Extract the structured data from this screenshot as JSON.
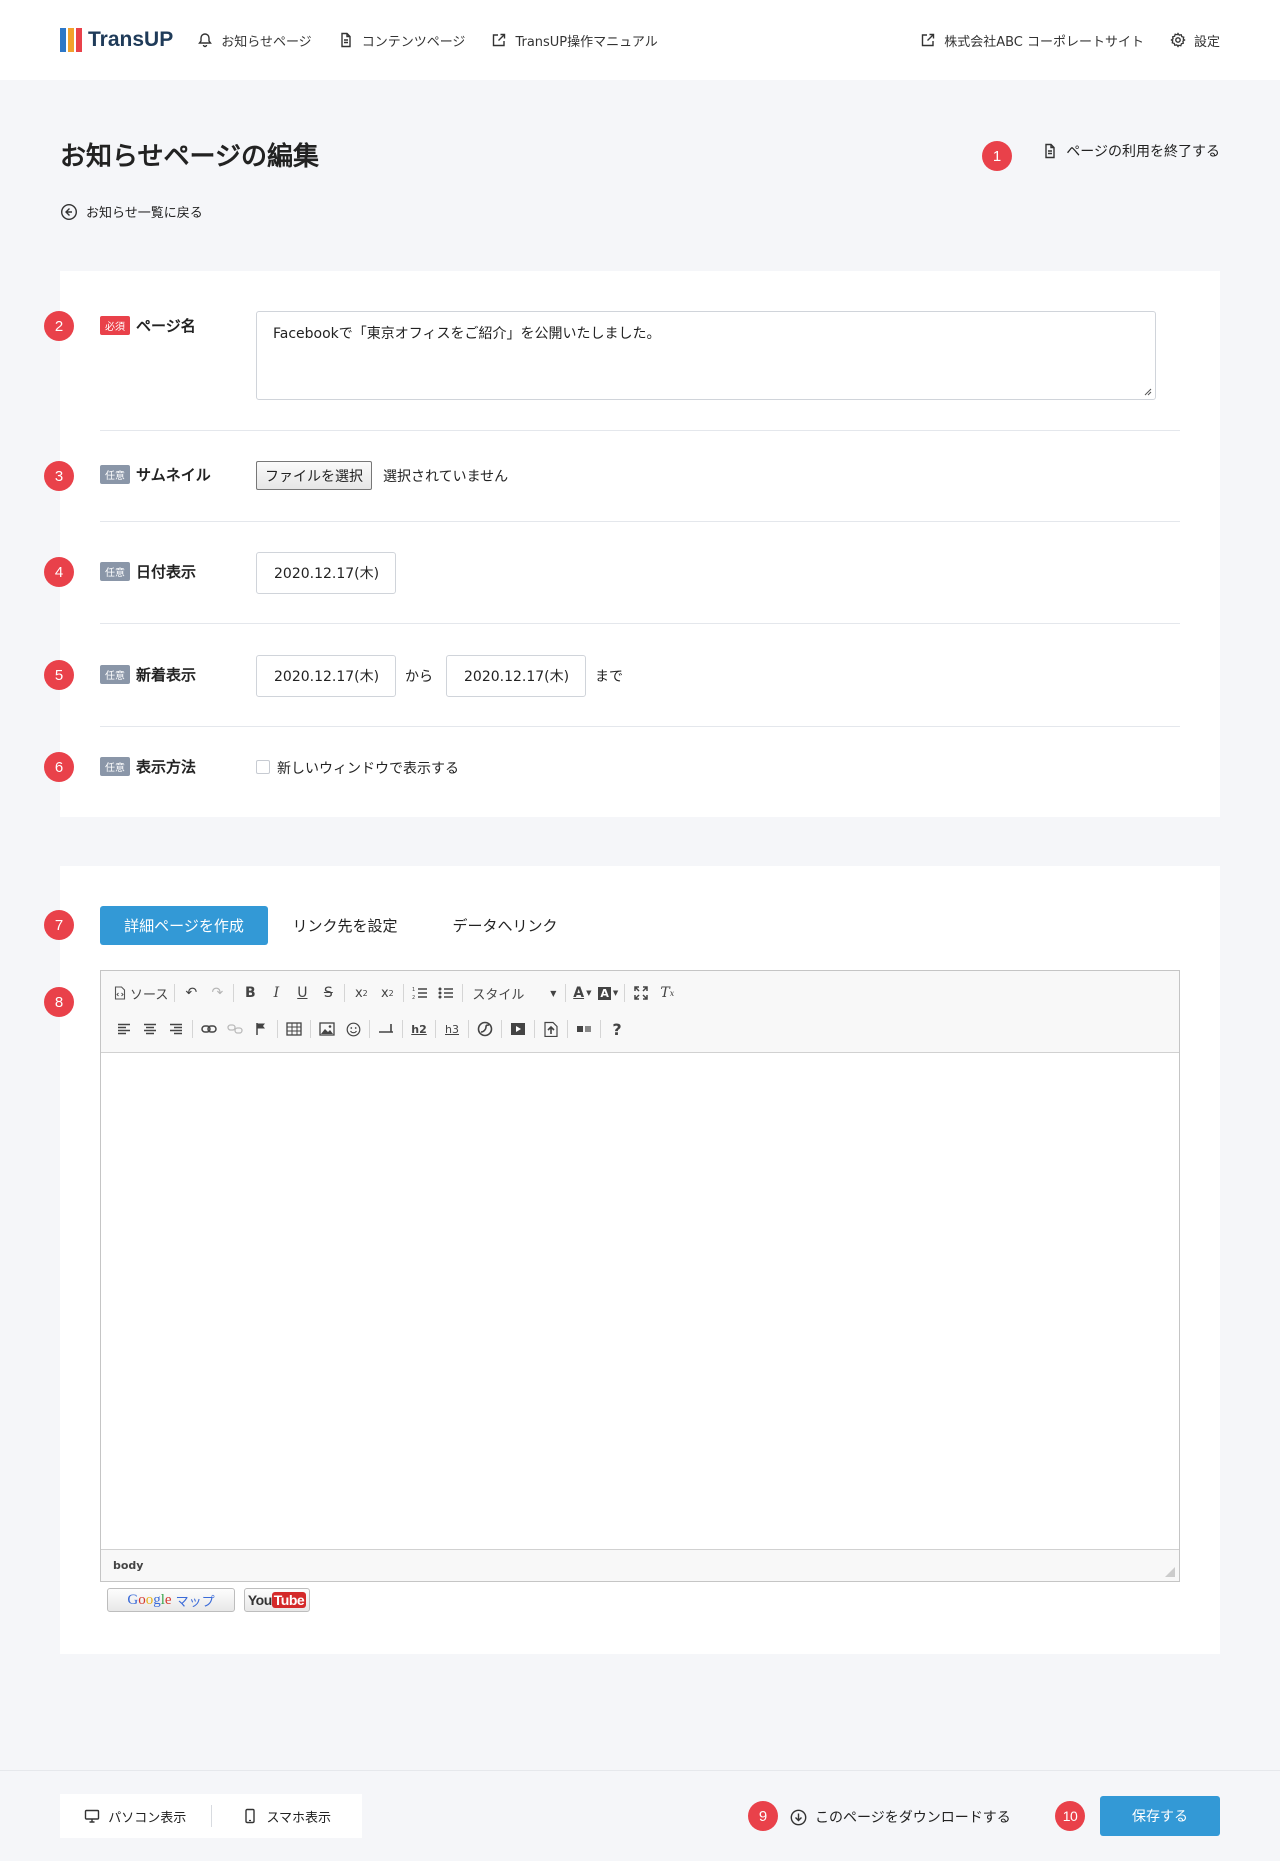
{
  "header": {
    "logo_text": "TransUP",
    "nav": [
      {
        "label": "お知らせページ",
        "icon": "bell-icon"
      },
      {
        "label": "コンテンツページ",
        "icon": "document-icon"
      },
      {
        "label": "TransUP操作マニュアル",
        "icon": "external-link-icon"
      }
    ],
    "right_nav": [
      {
        "label": "株式会社ABC コーポレートサイト",
        "icon": "external-link-icon"
      },
      {
        "label": "設定",
        "icon": "gear-icon"
      }
    ]
  },
  "page": {
    "title": "お知らせページの編集",
    "end_use_label": "ページの利用を終了する",
    "back_label": "お知らせ一覧に戻る"
  },
  "markers": [
    "1",
    "2",
    "3",
    "4",
    "5",
    "6",
    "7",
    "8",
    "9",
    "10"
  ],
  "form": {
    "page_name": {
      "badge": "必須",
      "label": "ページ名",
      "value": "Facebookで「東京オフィスをご紹介」を公開いたしました。"
    },
    "thumbnail": {
      "badge": "任意",
      "label": "サムネイル",
      "button_label": "ファイルを選択",
      "status": "選択されていません"
    },
    "date_display": {
      "badge": "任意",
      "label": "日付表示",
      "value": "2020.12.17(木)"
    },
    "new_display": {
      "badge": "任意",
      "label": "新着表示",
      "from_value": "2020.12.17(木)",
      "from_label": "から",
      "to_value": "2020.12.17(木)",
      "to_label": "まで"
    },
    "display_method": {
      "badge": "任意",
      "label": "表示方法",
      "checkbox_label": "新しいウィンドウで表示する",
      "checked": false
    }
  },
  "tabs": [
    {
      "label": "詳細ページを作成",
      "active": true
    },
    {
      "label": "リンク先を設定",
      "active": false
    },
    {
      "label": "データへリンク",
      "active": false
    }
  ],
  "editor": {
    "source_label": "ソース",
    "style_label": "スタイル",
    "status_path": "body",
    "plugins": {
      "google_maps": "マップ",
      "google": "Google",
      "youtube_you": "You",
      "youtube_tube": "Tube"
    }
  },
  "footer": {
    "pc_view": "パソコン表示",
    "sp_view": "スマホ表示",
    "download_label": "このページをダウンロードする",
    "save_label": "保存する"
  },
  "colors": {
    "accent": "#3399d6",
    "marker": "#e9414a",
    "required": "#e9414a",
    "optional": "#8a96a8"
  }
}
